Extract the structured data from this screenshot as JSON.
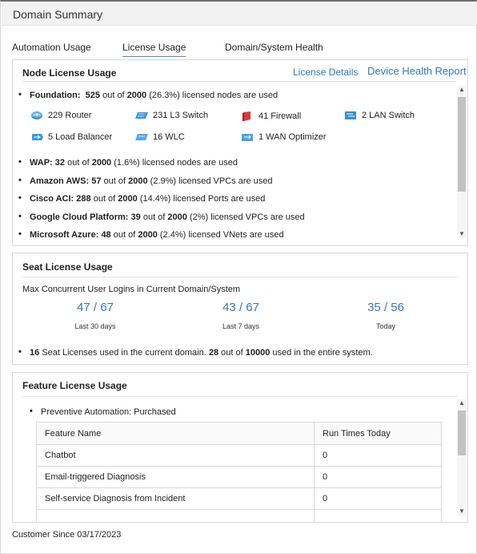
{
  "window": {
    "title": "Domain Summary"
  },
  "tabs": [
    {
      "label": "Automation Usage"
    },
    {
      "label": "License Usage",
      "active": true
    },
    {
      "label": "Domain/System Health"
    }
  ],
  "node_license": {
    "title": "Node License Usage",
    "license_details_link": "License Details",
    "device_health_link": "Device Health Report",
    "foundation": {
      "label": "Foundation:",
      "used": "525",
      "mid": "out of",
      "total": "2000",
      "rest": "(26.3%) licensed nodes are used"
    },
    "devices": [
      {
        "text": "229 Router",
        "icon": "router-icon"
      },
      {
        "text": "231 L3 Switch",
        "icon": "l3-switch-icon"
      },
      {
        "text": "41 Firewall",
        "icon": "firewall-icon"
      },
      {
        "text": "2 LAN Switch",
        "icon": "lan-switch-icon"
      },
      {
        "text": "5 Load Balancer",
        "icon": "load-balancer-icon"
      },
      {
        "text": "16 WLC",
        "icon": "wlc-icon"
      },
      {
        "text": "1 WAN Optimizer",
        "icon": "wan-optimizer-icon"
      }
    ],
    "items": [
      {
        "label": "WAP:",
        "used": "32",
        "mid": "out of",
        "total": "2000",
        "rest": "(1.6%) licensed nodes are used"
      },
      {
        "label": "Amazon AWS:",
        "used": "57",
        "mid": "out of",
        "total": "2000",
        "rest": "(2.9%) licensed VPCs are used"
      },
      {
        "label": "Cisco ACI:",
        "used": "288",
        "mid": "out of",
        "total": "2000",
        "rest": "(14.4%) licensed Ports are used"
      },
      {
        "label": "Google Cloud Platform:",
        "used": "39",
        "mid": "out of",
        "total": "2000",
        "rest": "(2%) licensed VPCs are used"
      },
      {
        "label": "Microsoft Azure:",
        "used": "48",
        "mid": "out of",
        "total": "2000",
        "rest": "(2.4%) licensed VNets are used"
      }
    ],
    "scroll_position": 0.0
  },
  "seat_license": {
    "title": "Seat License Usage",
    "subtitle": "Max Concurrent User Logins in Current Domain/System",
    "stats": [
      {
        "value": "47 / 67",
        "label": "Last 30 days"
      },
      {
        "value": "43 / 67",
        "label": "Last 7 days"
      },
      {
        "value": "35 / 56",
        "label": "Today"
      }
    ],
    "summary": {
      "seats": "16",
      "part1": "Seat Licenses used in the current domain.",
      "used": "28",
      "mid": "out of",
      "total": "10000",
      "part2": "used in the entire system."
    }
  },
  "feature_license": {
    "title": "Feature License Usage",
    "bullet": "Preventive Automation: Purchased",
    "columns": [
      "Feature Name",
      "Run Times Today"
    ],
    "rows": [
      [
        "Chatbot",
        "0"
      ],
      [
        "Email-triggered Diagnosis",
        "0"
      ],
      [
        "Self-service Diagnosis from Incident",
        "0"
      ]
    ]
  },
  "footer": {
    "text": "Customer Since 03/17/2023"
  },
  "colors": {
    "link": "#2f7bbf",
    "stat_value": "#3a77b3",
    "tab_underline": "#4a8fd0"
  }
}
